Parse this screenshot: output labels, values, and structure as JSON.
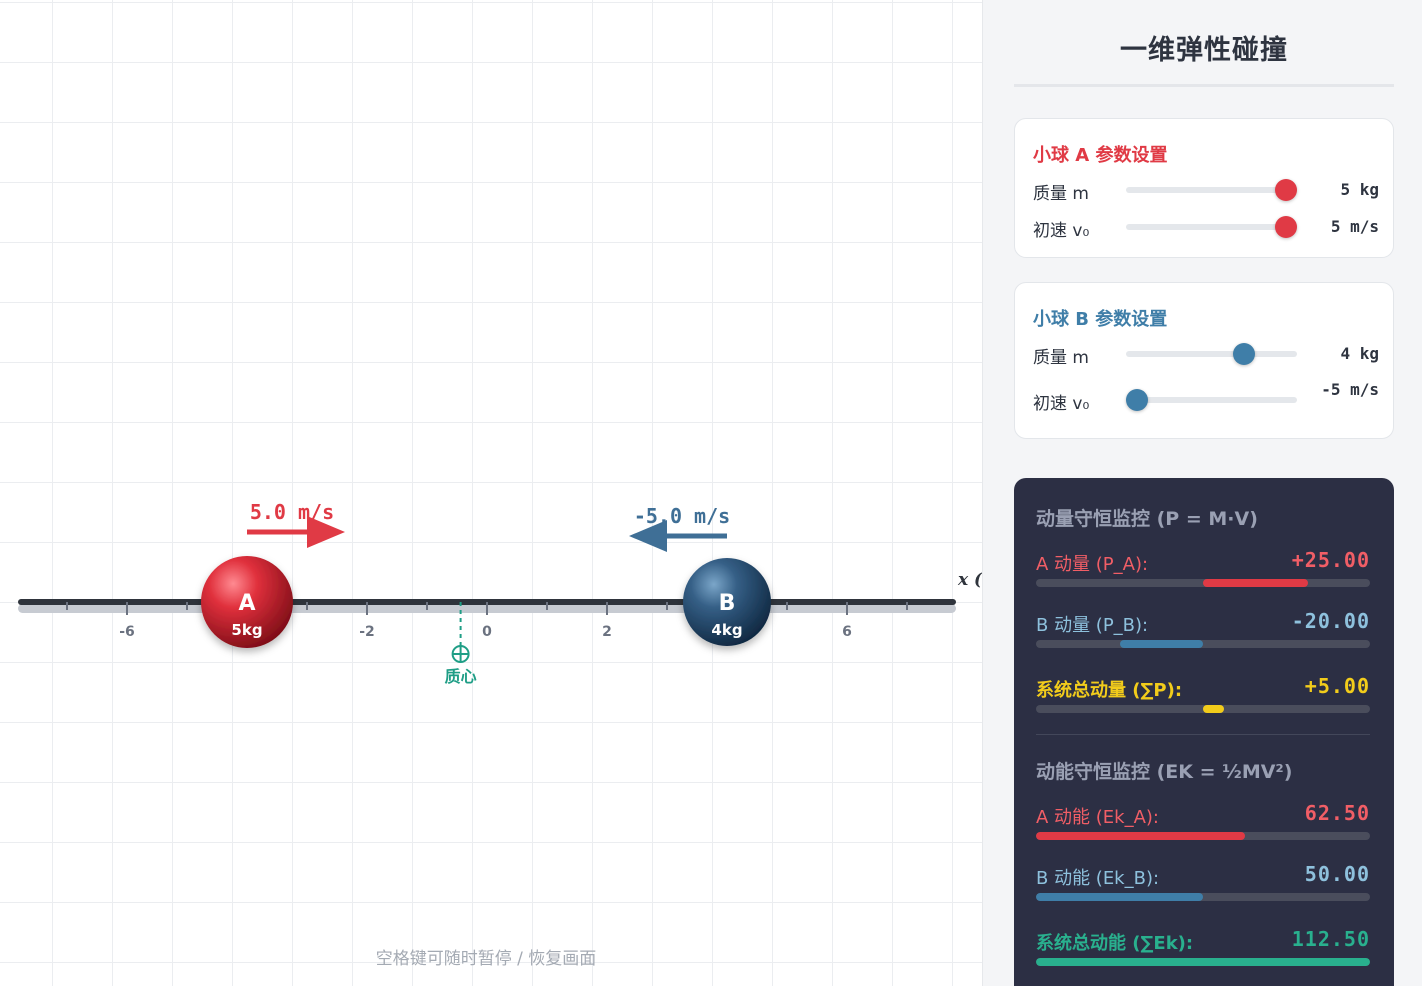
{
  "stage": {
    "axis": {
      "x_label": "x (",
      "tick_labels": [
        {
          "value": -6,
          "text": "-6"
        },
        {
          "value": -2,
          "text": "-2"
        },
        {
          "value": 0,
          "text": "0"
        },
        {
          "value": 2,
          "text": "2"
        },
        {
          "value": 6,
          "text": "6"
        }
      ],
      "minor_ticks": [
        -7,
        -5,
        -4,
        -3,
        -1,
        1,
        3,
        4,
        5,
        7
      ]
    },
    "ball_a": {
      "letter": "A",
      "mass_label": "5kg",
      "position": -4,
      "velocity_label": "5.0 m/s",
      "color": "#e03a45",
      "arrow": "right"
    },
    "ball_b": {
      "letter": "B",
      "mass_label": "4kg",
      "position": 4,
      "velocity_label": "-5.0 m/s",
      "color": "#3f6f96",
      "arrow": "left"
    },
    "center_of_mass": {
      "label": "质心",
      "position": -0.44,
      "color": "#1f9e86"
    },
    "hint": "空格键可随时暂停 / 恢复画面"
  },
  "sidebar": {
    "title": "一维弹性碰撞",
    "ball_a_settings": {
      "title": "小球 A 参数设置",
      "color": "#e03a45",
      "mass": {
        "label": "质量 m",
        "value": "5 kg",
        "fraction": 1.0
      },
      "velocity": {
        "label": "初速 v₀",
        "value": "5 m/s",
        "fraction": 1.0
      }
    },
    "ball_b_settings": {
      "title": "小球 B 参数设置",
      "color": "#3f7ea8",
      "mass": {
        "label": "质量 m",
        "value": "4 kg",
        "fraction": 0.72
      },
      "velocity": {
        "label": "初速 v₀",
        "value": "-5 m/s",
        "fraction": 0.0
      }
    },
    "momentum": {
      "heading": "动量守恒监控 (P = M·V)",
      "rows": [
        {
          "label": "A 动量 (P_A):",
          "value": "+25.00",
          "color": "#f15e66",
          "bar_color": "#e03a45",
          "from": 0.5,
          "to": 0.813
        },
        {
          "label": "B 动量 (P_B):",
          "value": "-20.00",
          "color": "#8ec1dd",
          "bar_color": "#3f7ea8",
          "from": 0.25,
          "to": 0.5
        },
        {
          "label": "系统总动量 (∑P):",
          "value": "+5.00",
          "color": "#f2cc1b",
          "bar_color": "#f2cc1b",
          "from": 0.5,
          "to": 0.563
        }
      ]
    },
    "energy": {
      "heading": "动能守恒监控 (EK = ½MV²)",
      "rows": [
        {
          "label": "A 动能 (Ek_A):",
          "value": "62.50",
          "color": "#f15e66",
          "bar_color": "#e03a45",
          "from": 0.0,
          "to": 0.625
        },
        {
          "label": "B 动能 (Ek_B):",
          "value": "50.00",
          "color": "#8ec1dd",
          "bar_color": "#3f7ea8",
          "from": 0.0,
          "to": 0.5
        },
        {
          "label": "系统总动能 (∑Ek):",
          "value": "112.50",
          "color": "#29b08e",
          "bar_color": "#29b08e",
          "from": 0.0,
          "to": 1.0
        }
      ]
    }
  }
}
